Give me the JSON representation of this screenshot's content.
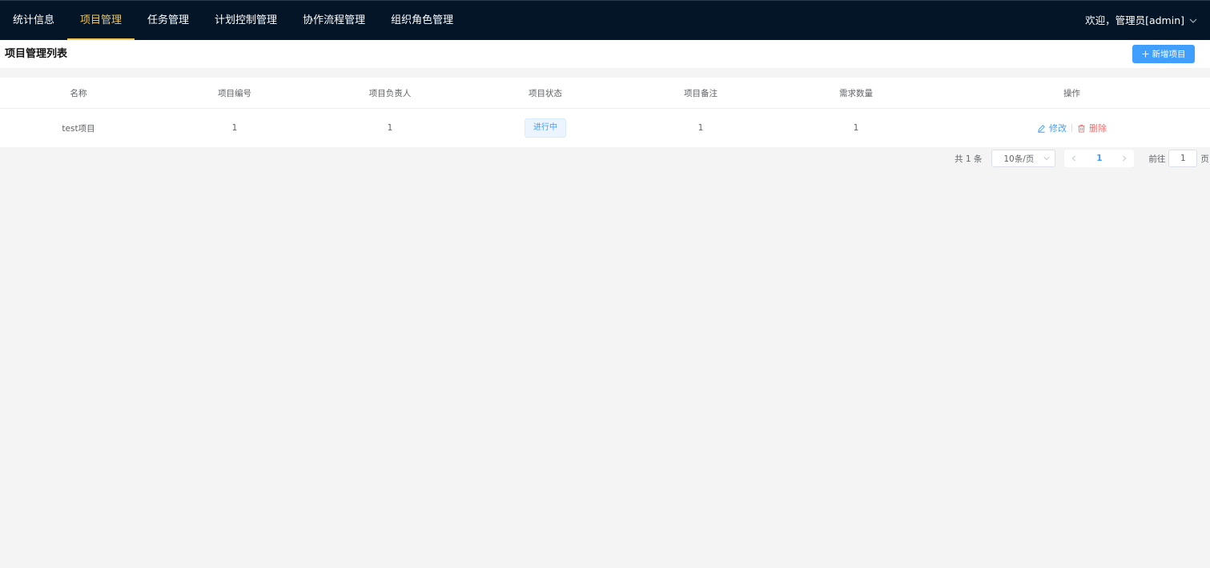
{
  "nav": {
    "items": [
      {
        "label": "统计信息"
      },
      {
        "label": "项目管理"
      },
      {
        "label": "任务管理"
      },
      {
        "label": "计划控制管理"
      },
      {
        "label": "协作流程管理"
      },
      {
        "label": "组织角色管理"
      }
    ],
    "active_index": 1,
    "user_label": "欢迎，管理员[admin]"
  },
  "page": {
    "title": "项目管理列表",
    "add_button_label": "新增项目"
  },
  "table": {
    "columns": [
      "名称",
      "项目编号",
      "项目负责人",
      "项目状态",
      "项目备注",
      "需求数量",
      "操作"
    ],
    "rows": [
      {
        "name": "test项目",
        "code": "1",
        "owner": "1",
        "status": "进行中",
        "remark": "1",
        "demand_count": "1",
        "edit_label": "修改",
        "delete_label": "删除"
      }
    ]
  },
  "pagination": {
    "total_text": "共 1 条",
    "page_size": "10条/页",
    "current_page": "1",
    "goto_prefix": "前往",
    "goto_value": "1",
    "goto_suffix": "页"
  },
  "colors": {
    "topbar": "#041527",
    "active_nav": "#f3c54b",
    "primary": "#409eff",
    "danger": "#f56c6c"
  }
}
